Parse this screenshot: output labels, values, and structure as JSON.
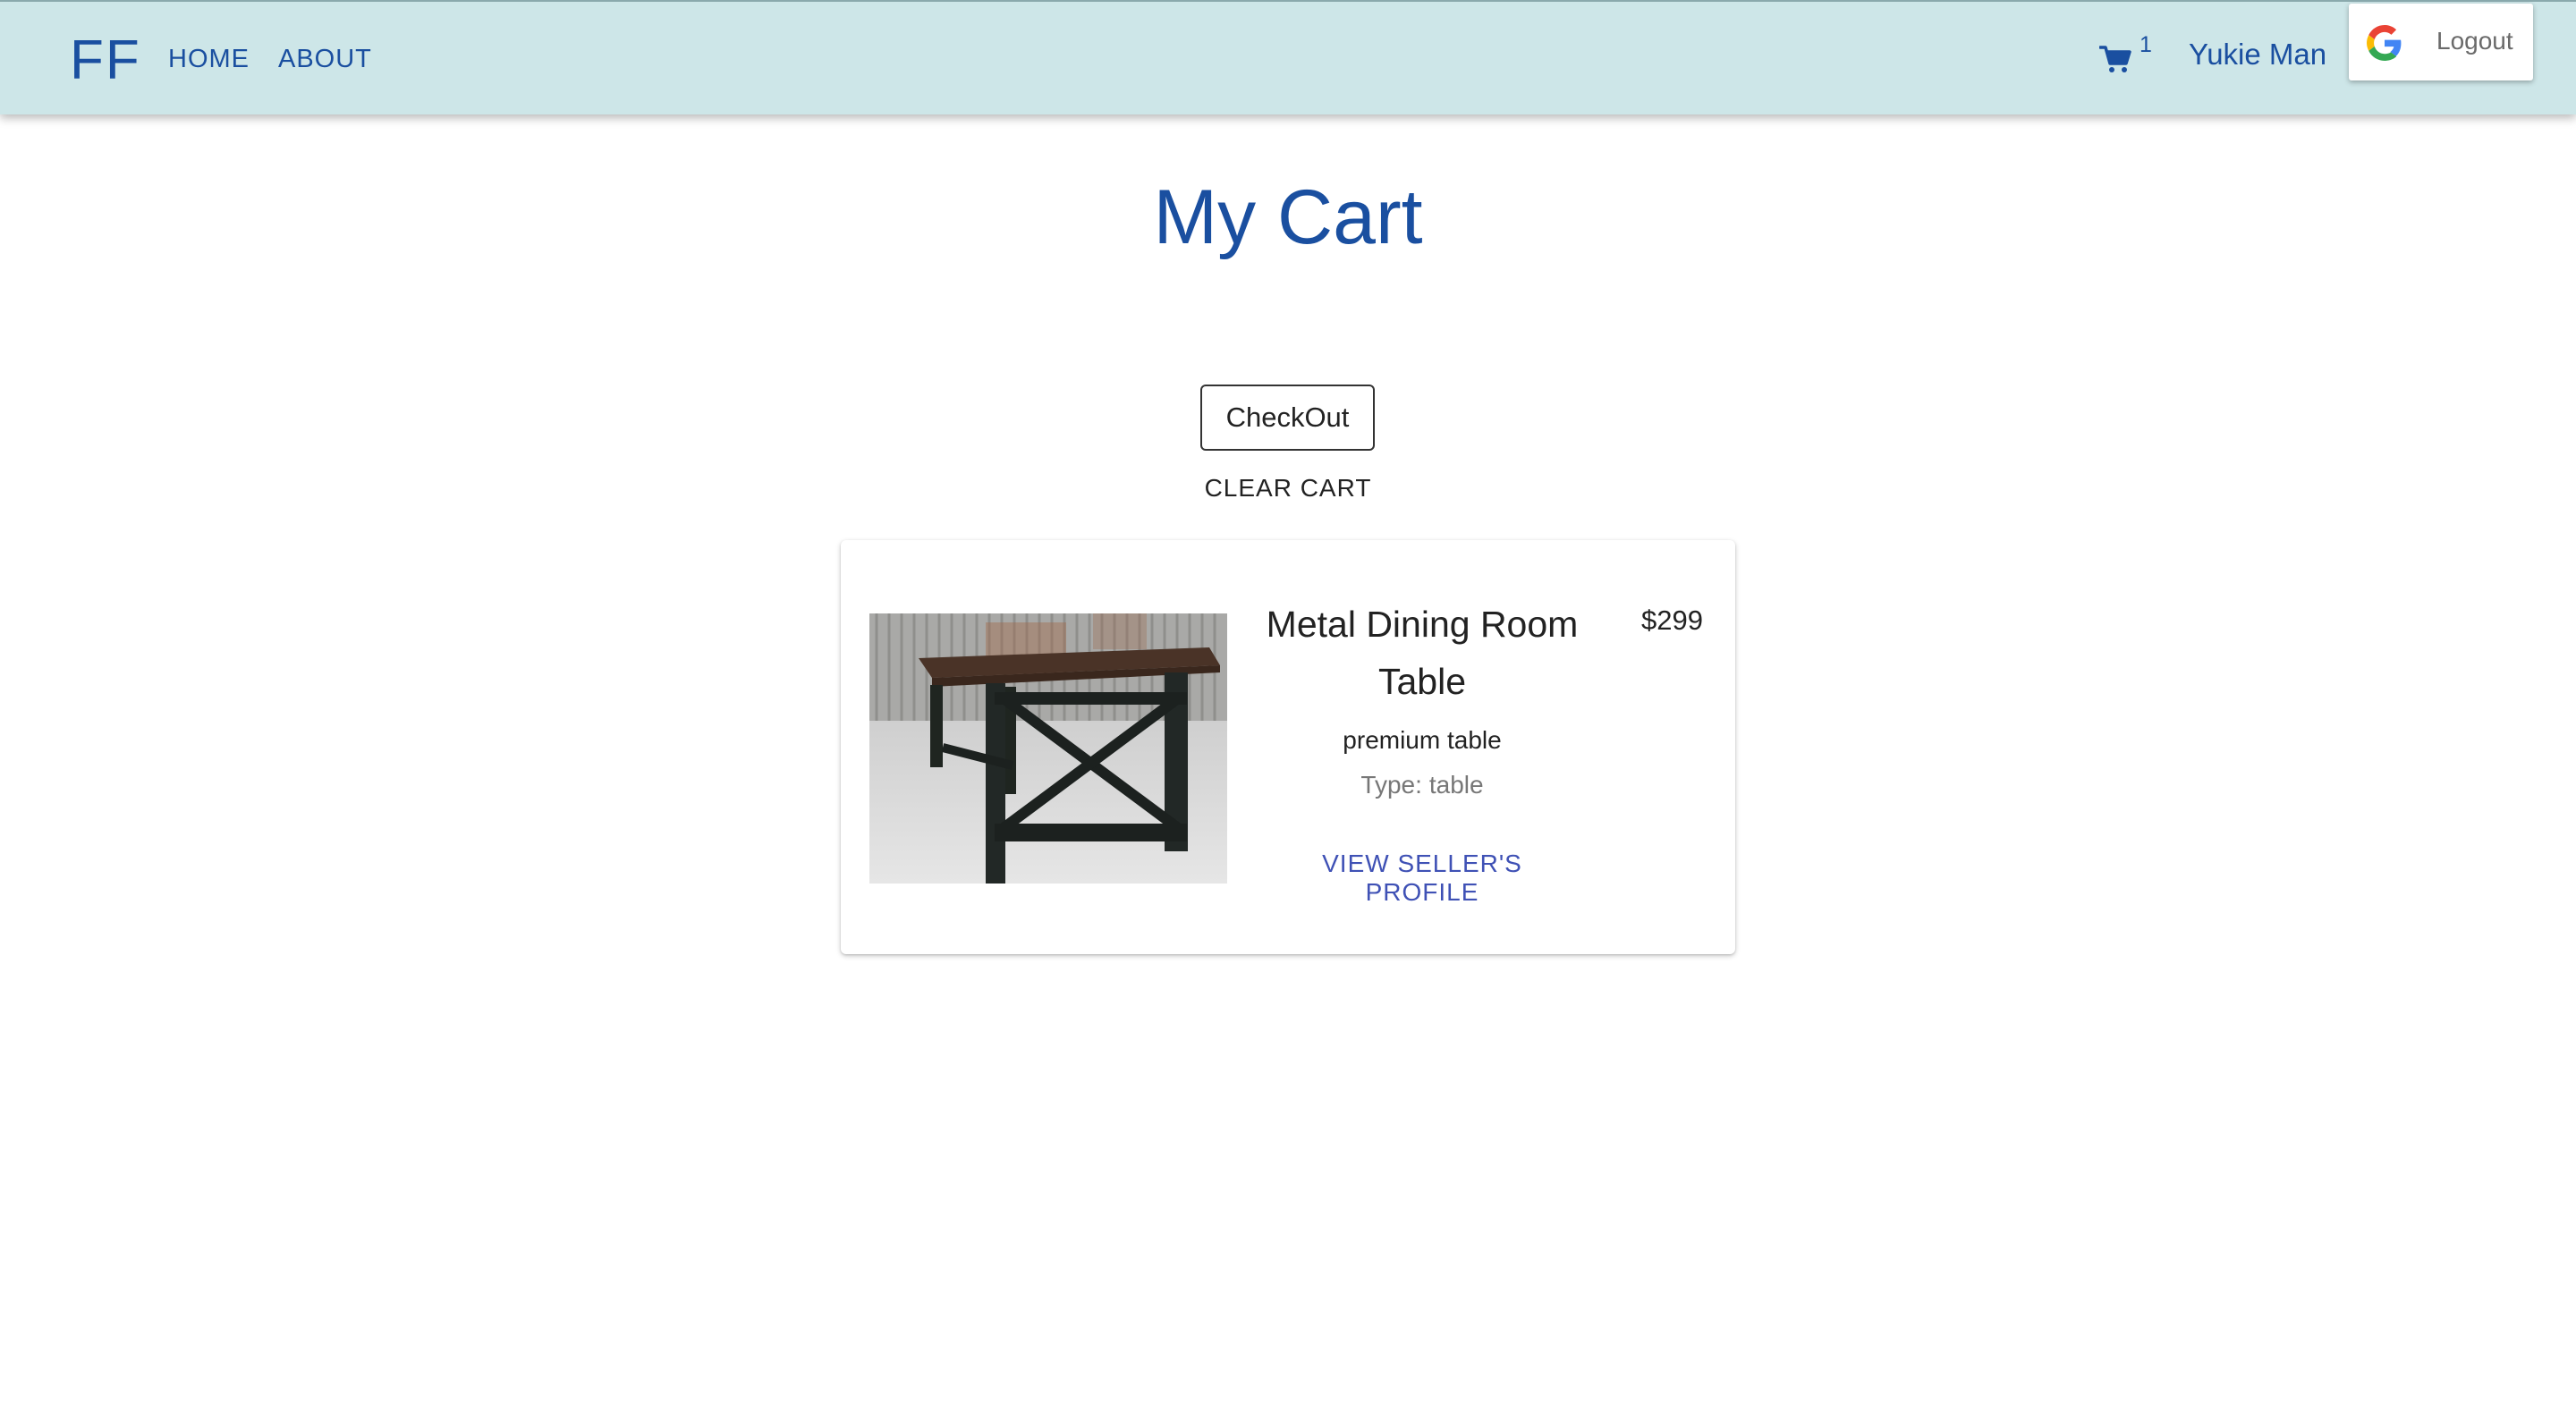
{
  "header": {
    "logo": "FF",
    "nav": [
      {
        "label": "HOME"
      },
      {
        "label": "ABOUT"
      }
    ],
    "cart_count": "1",
    "user_name": "Yukie Man",
    "logout_label": "Logout",
    "cart_icon": "shopping-cart-icon",
    "login_icon": "google-icon"
  },
  "page": {
    "title": "My Cart",
    "checkout_label": "CheckOut",
    "clear_cart_label": "CLEAR CART"
  },
  "cart_items": [
    {
      "name": "Metal Dining Room Table",
      "price": "$299",
      "description": "premium table",
      "type_label": "Type:",
      "type_value": "table",
      "seller_link": "VIEW SELLER'S PROFILE",
      "image": "metal dining table photo"
    }
  ],
  "colors": {
    "navbar_bg": "#cde6e8",
    "brand_blue": "#1a4fa0",
    "link_indigo": "#3f51b5"
  }
}
